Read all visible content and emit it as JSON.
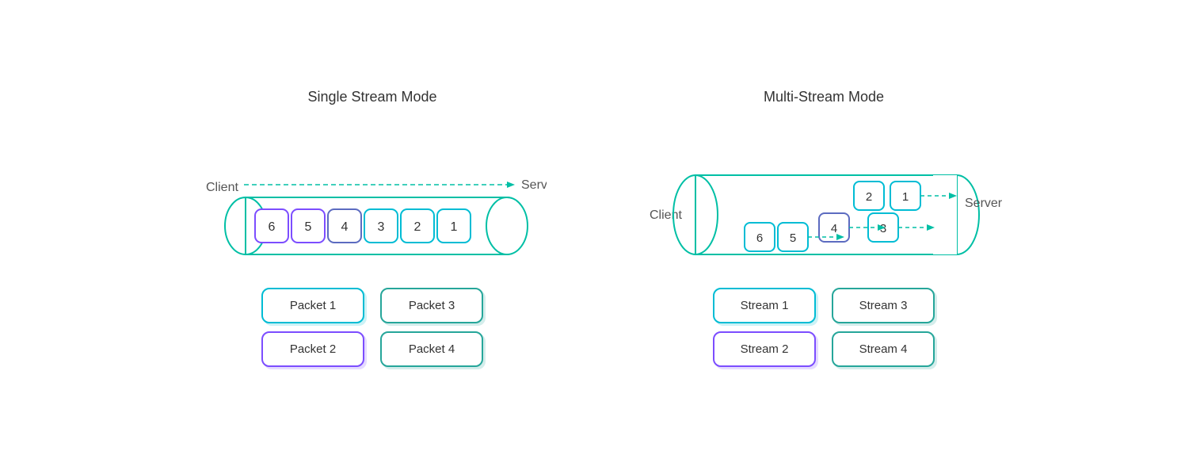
{
  "left": {
    "title": "Single Stream Mode",
    "client_label": "Client",
    "server_label": "Server",
    "packets": [
      6,
      5,
      4,
      3,
      2,
      1
    ],
    "legend": [
      {
        "label": "Packet 1",
        "color": "cyan"
      },
      {
        "label": "Packet 3",
        "color": "teal"
      },
      {
        "label": "Packet 2",
        "color": "purple"
      },
      {
        "label": "Packet 4",
        "color": "teal"
      }
    ]
  },
  "right": {
    "title": "Multi-Stream Mode",
    "client_label": "Client",
    "server_label": "Server",
    "streams_legend": [
      {
        "label": "Stream 1",
        "color": "cyan"
      },
      {
        "label": "Stream 3",
        "color": "teal"
      },
      {
        "label": "Stream 2",
        "color": "purple"
      },
      {
        "label": "Stream 4",
        "color": "teal"
      }
    ]
  }
}
